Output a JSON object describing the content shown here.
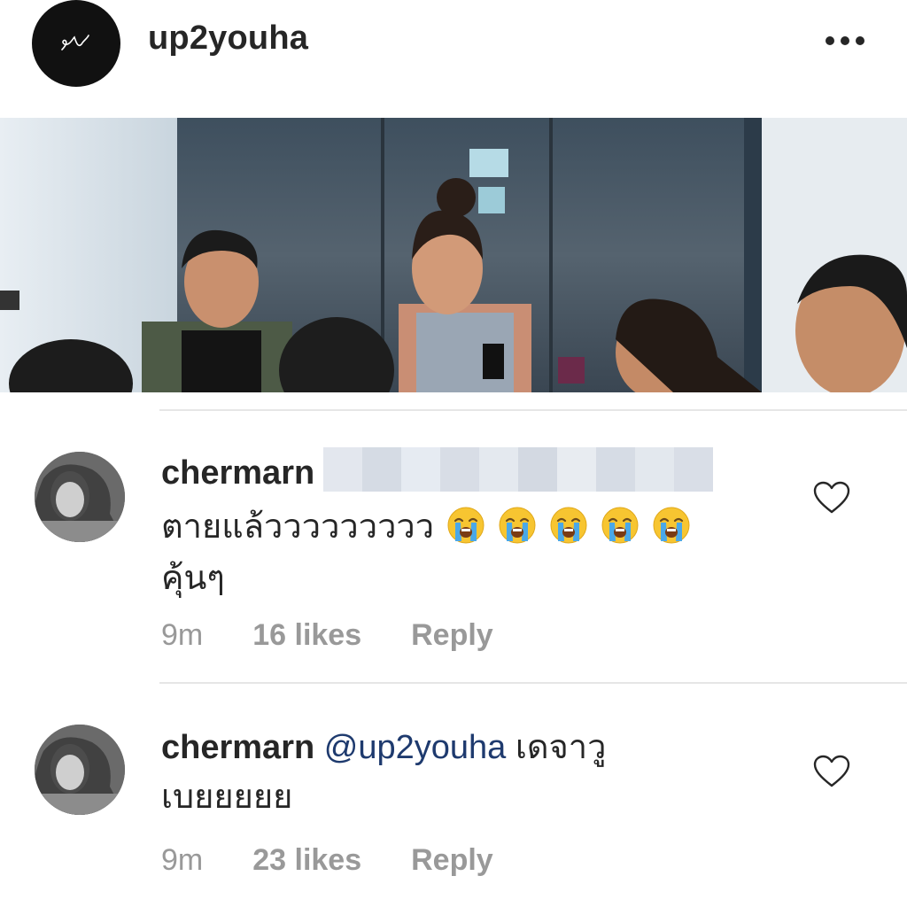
{
  "post": {
    "username": "up2youha",
    "more_icon": "more-horizontal-icon",
    "avatar_icon": "signature-logo-icon"
  },
  "video": {
    "description": "video-thumbnail"
  },
  "comments": [
    {
      "username": "chermarn",
      "text_line1": "ตายแล้ววววววววว",
      "emoji_count": 5,
      "emoji_icon": "loudly-crying-face-emoji",
      "text_line2": "คุ้นๆ",
      "time": "9m",
      "likes": "16 likes",
      "reply": "Reply",
      "heart_icon": "heart-outline-icon"
    },
    {
      "username": "chermarn",
      "mention": "@up2youha",
      "text_line1": "เดจาวู",
      "text_line2": "เบยยยยย",
      "time": "9m",
      "likes": "23 likes",
      "reply": "Reply",
      "heart_icon": "heart-outline-icon"
    }
  ],
  "colors": {
    "mention": "#1e3a6e",
    "meta": "#999999",
    "text": "#262626"
  }
}
